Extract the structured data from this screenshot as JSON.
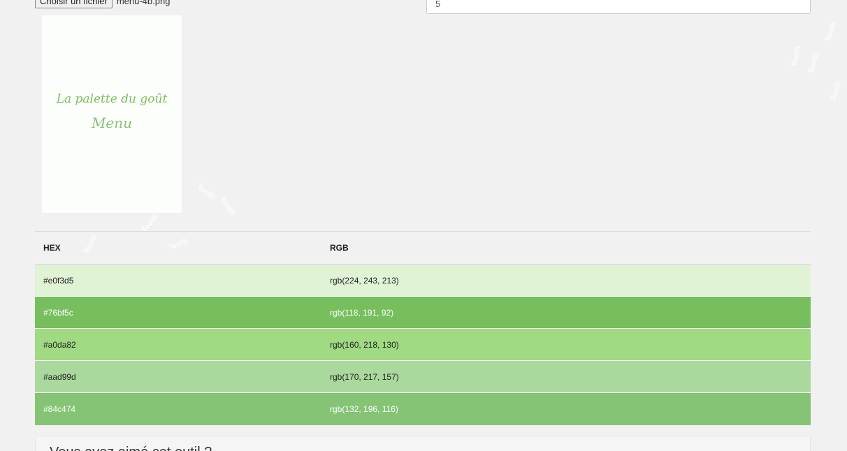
{
  "upload": {
    "button_label": "Choisir un fichier",
    "file_name": "menu-4b.png"
  },
  "color_count": {
    "value": "5"
  },
  "preview": {
    "brand_text": "La palette du goût",
    "menu_text": "Menu"
  },
  "watermark": {
    "text": "Toolli"
  },
  "table": {
    "headers": {
      "hex": "HEX",
      "rgb": "RGB"
    },
    "rows": [
      {
        "hex": "#e0f3d5",
        "rgb": "rgb(224, 243, 213)",
        "color": "#e0f3d5",
        "text_tone": "light"
      },
      {
        "hex": "#76bf5c",
        "rgb": "rgb(118, 191, 92)",
        "color": "#76bf5c",
        "text_tone": "dark"
      },
      {
        "hex": "#a0da82",
        "rgb": "rgb(160, 218, 130)",
        "color": "#a0da82",
        "text_tone": "light"
      },
      {
        "hex": "#aad99d",
        "rgb": "rgb(170, 217, 157)",
        "color": "#aad99d",
        "text_tone": "light"
      },
      {
        "hex": "#84c474",
        "rgb": "rgb(132, 196, 116)",
        "color": "#84c474",
        "text_tone": "dark"
      }
    ]
  },
  "feedback": {
    "title": "Vous avez aimé cet outil ?"
  }
}
